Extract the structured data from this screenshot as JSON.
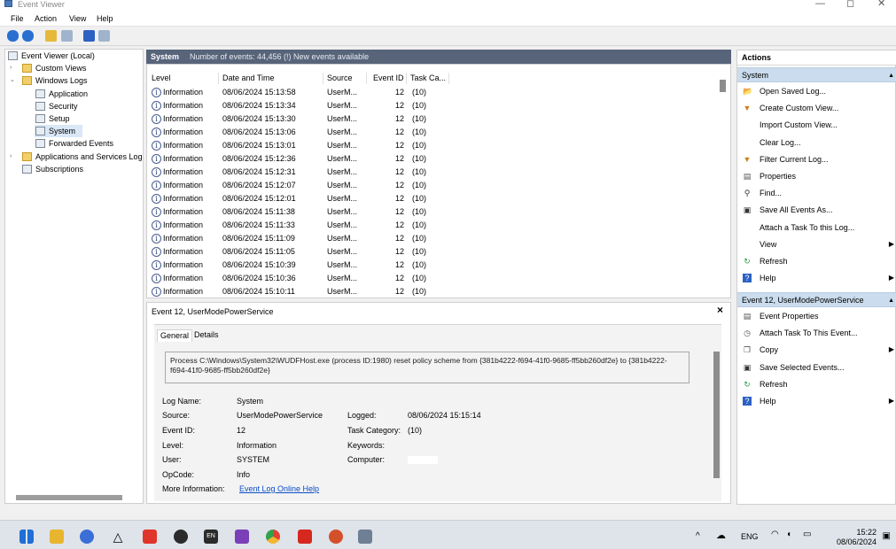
{
  "window": {
    "title": "Event Viewer"
  },
  "menu": [
    "File",
    "Action",
    "View",
    "Help"
  ],
  "tree": {
    "root": "Event Viewer (Local)",
    "custom_views": "Custom Views",
    "windows_logs": "Windows Logs",
    "application": "Application",
    "security": "Security",
    "setup": "Setup",
    "system": "System",
    "forwarded": "Forwarded Events",
    "apps_services": "Applications and Services Log",
    "subscriptions": "Subscriptions"
  },
  "events_panel": {
    "title": "System",
    "summary": "Number of events: 44,456 (!) New events available",
    "columns": [
      "Level",
      "Date and Time",
      "Source",
      "Event ID",
      "Task Ca..."
    ],
    "rows": [
      {
        "level": "Information",
        "datetime": "08/06/2024 15:13:58",
        "source": "UserM...",
        "event_id": "12",
        "task": "(10)"
      },
      {
        "level": "Information",
        "datetime": "08/06/2024 15:13:34",
        "source": "UserM...",
        "event_id": "12",
        "task": "(10)"
      },
      {
        "level": "Information",
        "datetime": "08/06/2024 15:13:30",
        "source": "UserM...",
        "event_id": "12",
        "task": "(10)"
      },
      {
        "level": "Information",
        "datetime": "08/06/2024 15:13:06",
        "source": "UserM...",
        "event_id": "12",
        "task": "(10)"
      },
      {
        "level": "Information",
        "datetime": "08/06/2024 15:13:01",
        "source": "UserM...",
        "event_id": "12",
        "task": "(10)"
      },
      {
        "level": "Information",
        "datetime": "08/06/2024 15:12:36",
        "source": "UserM...",
        "event_id": "12",
        "task": "(10)"
      },
      {
        "level": "Information",
        "datetime": "08/06/2024 15:12:31",
        "source": "UserM...",
        "event_id": "12",
        "task": "(10)"
      },
      {
        "level": "Information",
        "datetime": "08/06/2024 15:12:07",
        "source": "UserM...",
        "event_id": "12",
        "task": "(10)"
      },
      {
        "level": "Information",
        "datetime": "08/06/2024 15:12:01",
        "source": "UserM...",
        "event_id": "12",
        "task": "(10)"
      },
      {
        "level": "Information",
        "datetime": "08/06/2024 15:11:38",
        "source": "UserM...",
        "event_id": "12",
        "task": "(10)"
      },
      {
        "level": "Information",
        "datetime": "08/06/2024 15:11:33",
        "source": "UserM...",
        "event_id": "12",
        "task": "(10)"
      },
      {
        "level": "Information",
        "datetime": "08/06/2024 15:11:09",
        "source": "UserM...",
        "event_id": "12",
        "task": "(10)"
      },
      {
        "level": "Information",
        "datetime": "08/06/2024 15:11:05",
        "source": "UserM...",
        "event_id": "12",
        "task": "(10)"
      },
      {
        "level": "Information",
        "datetime": "08/06/2024 15:10:39",
        "source": "UserM...",
        "event_id": "12",
        "task": "(10)"
      },
      {
        "level": "Information",
        "datetime": "08/06/2024 15:10:36",
        "source": "UserM...",
        "event_id": "12",
        "task": "(10)"
      },
      {
        "level": "Information",
        "datetime": "08/06/2024 15:10:11",
        "source": "UserM...",
        "event_id": "12",
        "task": "(10)"
      }
    ]
  },
  "detail": {
    "title": "Event 12, UserModePowerService",
    "close": "×",
    "tabs": [
      "General",
      "Details"
    ],
    "description": "Process C:\\Windows\\System32\\WUDFHost.exe (process ID:1980) reset policy scheme from {381b4222-f694-41f0-9685-ff5bb260df2e} to {381b4222-f694-41f0-9685-ff5bb260df2e}",
    "labels": {
      "log_name": "Log Name:",
      "source": "Source:",
      "event_id": "Event ID:",
      "level": "Level:",
      "user": "User:",
      "opcode": "OpCode:",
      "more_info": "More Information:",
      "logged": "Logged:",
      "task_category": "Task Category:",
      "keywords": "Keywords:",
      "computer": "Computer:"
    },
    "values": {
      "log_name": "System",
      "source": "UserModePowerService",
      "event_id": "12",
      "level": "Information",
      "user": "SYSTEM",
      "opcode": "Info",
      "more_info_link": "Event Log Online Help",
      "logged": "08/06/2024 15:15:14",
      "task_category": "(10)"
    }
  },
  "actions": {
    "header": "Actions",
    "group1": "System",
    "group1_items": [
      "Open Saved Log...",
      "Create Custom View...",
      "Import Custom View...",
      "Clear Log...",
      "Filter Current Log...",
      "Properties",
      "Find...",
      "Save All Events As...",
      "Attach a Task To this Log...",
      "View",
      "Refresh",
      "Help"
    ],
    "group2": "Event 12, UserModePowerService",
    "group2_items": [
      "Event Properties",
      "Attach Task To This Event...",
      "Copy",
      "Save Selected Events...",
      "Refresh",
      "Help"
    ]
  },
  "taskbar": {
    "lang": "ENG",
    "time": "15:22",
    "date": "08/06/2024",
    "en_badge": "EN"
  }
}
